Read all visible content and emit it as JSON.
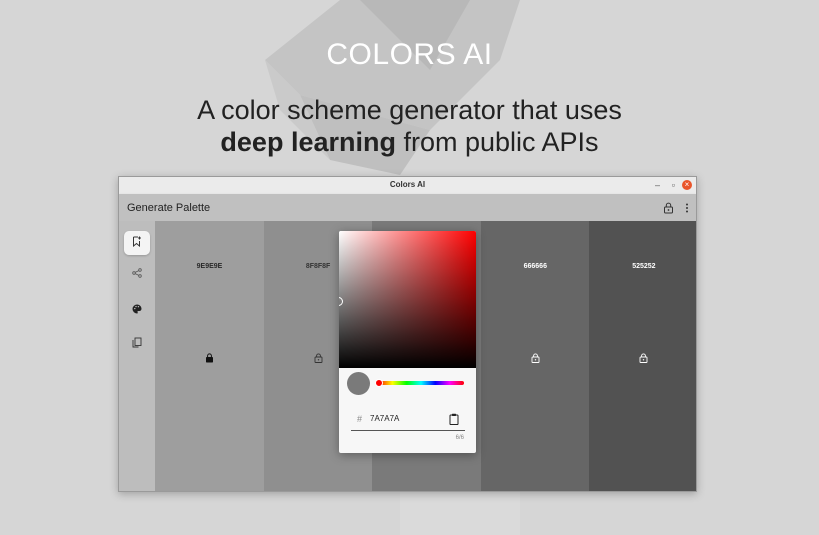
{
  "hero": {
    "title": "COLORS AI",
    "subtitle_line1": "A color scheme generator that uses",
    "subtitle_bold": "deep learning",
    "subtitle_rest": " from public APIs"
  },
  "window": {
    "title": "Colors AI",
    "minimize": "–",
    "maximize": "▫",
    "close": "×"
  },
  "appbar": {
    "title": "Generate Palette"
  },
  "rail": {
    "items": [
      {
        "icon": "bookmark-add-icon",
        "active": true
      },
      {
        "icon": "share-icon",
        "active": false
      },
      {
        "icon": "palette-icon",
        "active": false
      },
      {
        "icon": "copy-icon",
        "active": false
      }
    ]
  },
  "swatches": [
    {
      "hex": "9E9E9E",
      "color": "#9e9e9e",
      "locked": true,
      "text_color": "#2a2a2a"
    },
    {
      "hex": "8F8F8F",
      "color": "#8f8f8f",
      "locked": false,
      "text_color": "#333333"
    },
    {
      "hex": "7A7A7A",
      "color": "#7a7a7a",
      "locked": false,
      "text_color": "#ffffff"
    },
    {
      "hex": "666666",
      "color": "#666666",
      "locked": false,
      "text_color": "#ffffff"
    },
    {
      "hex": "525252",
      "color": "#525252",
      "locked": false,
      "text_color": "#ffffff"
    }
  ],
  "picker": {
    "hex_value": "7A7A7A",
    "hash": "#",
    "counter": "6/6",
    "preview_color": "#7a7a7a"
  }
}
